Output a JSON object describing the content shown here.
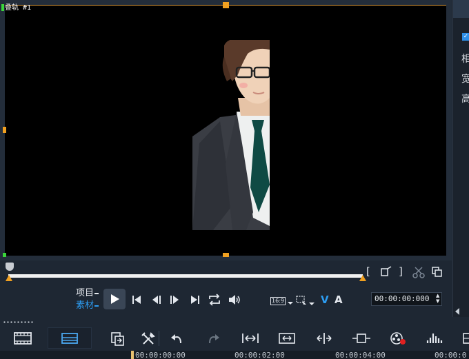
{
  "preview": {
    "track_label": "叠轨 #1"
  },
  "right_panel": {
    "check": "✓",
    "labels": [
      "相",
      "宽",
      "高"
    ]
  },
  "playback": {
    "mode_project": "项目",
    "mode_clip": "素材",
    "aspect_ratio": "16:9",
    "video_toggle": "V",
    "audio_toggle": "A",
    "timecode": "00:00:00:000"
  },
  "ruler": {
    "marks": [
      "00:00:00:00",
      "00:00:02:00",
      "00:00:04:00",
      "00:00:0"
    ]
  },
  "colors": {
    "accent_blue": "#2d9df2",
    "trim_orange": "#f0a020",
    "background": "#1e2733"
  },
  "icons": {
    "mark_in": "mark-in-icon",
    "mark_out": "mark-out-icon",
    "resize": "resize-icon",
    "split": "scissors-icon",
    "copy": "copy-icon",
    "home": "go-start-icon",
    "prev": "prev-frame-icon",
    "next": "next-frame-icon",
    "end": "go-end-icon",
    "repeat": "repeat-icon",
    "volume": "volume-icon"
  }
}
